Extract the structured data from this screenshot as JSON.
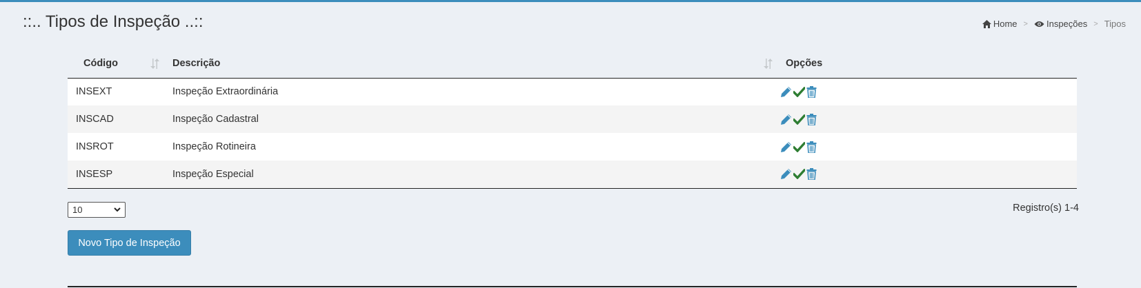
{
  "page": {
    "title": "::.. Tipos de Inspeção ..::"
  },
  "breadcrumb": {
    "items": [
      {
        "label": "Home",
        "icon": "home-icon"
      },
      {
        "label": "Inspeções",
        "icon": "eye-icon"
      },
      {
        "label": "Tipos"
      }
    ],
    "separator": ">"
  },
  "table": {
    "columns": [
      "Código",
      "Descrição",
      "Opções"
    ],
    "rows": [
      {
        "code": "INSEXT",
        "description": "Inspeção Extraordinária"
      },
      {
        "code": "INSCAD",
        "description": "Inspeção Cadastral"
      },
      {
        "code": "INSROT",
        "description": "Inspeção Rotineira"
      },
      {
        "code": "INSESP",
        "description": "Inspeção Especial"
      }
    ],
    "row_actions": [
      "pencil-icon",
      "check-icon",
      "trash-icon"
    ]
  },
  "pagination": {
    "page_size": "10",
    "records": "Registro(s) 1-4"
  },
  "actions": {
    "new_button": "Novo Tipo de Inspeção"
  },
  "colors": {
    "accent": "#3c8dbc",
    "edit": "#3c8dbc",
    "check": "#2e7d32",
    "background": "#ecf0f5"
  }
}
